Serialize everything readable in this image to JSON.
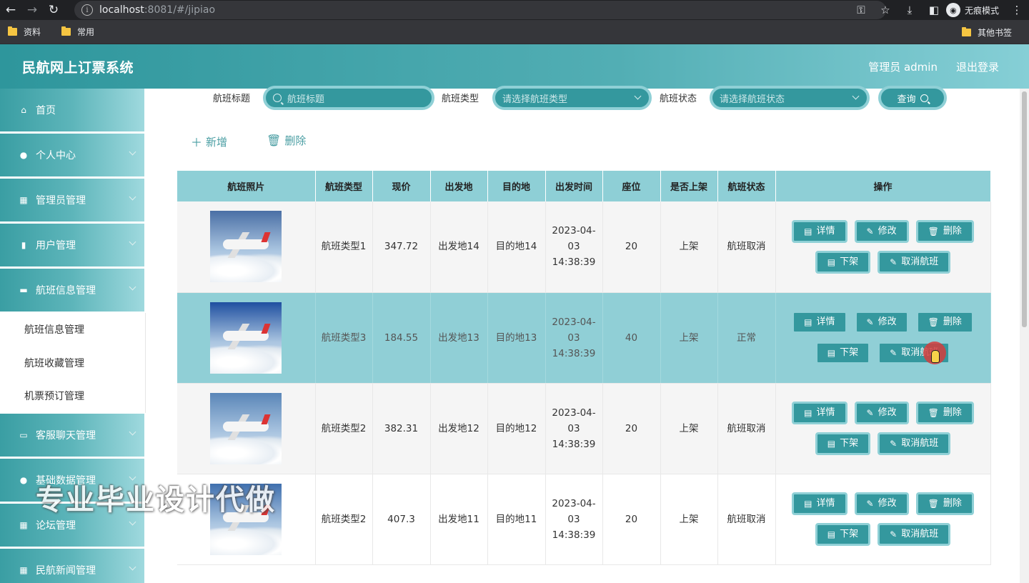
{
  "browser": {
    "url_host": "localhost",
    "url_rest": ":8081/#/jipiao",
    "incognito_label": "无痕模式",
    "bookmarks": [
      "资料",
      "常用"
    ],
    "other_bookmarks": "其他书签"
  },
  "header": {
    "title": "民航网上订票系统",
    "user": "管理员 admin",
    "logout": "退出登录"
  },
  "sidebar": {
    "items": [
      {
        "label": "首页",
        "icon": "home-icon",
        "glyph": "⌂"
      },
      {
        "label": "个人中心",
        "icon": "person-icon",
        "glyph": "●"
      },
      {
        "label": "管理员管理",
        "icon": "grid-icon",
        "glyph": "▦"
      },
      {
        "label": "用户管理",
        "icon": "chart-icon",
        "glyph": "▮"
      },
      {
        "label": "航班信息管理",
        "icon": "monitor-icon",
        "glyph": "▬"
      }
    ],
    "submenu": [
      "航班信息管理",
      "航班收藏管理",
      "机票预订管理"
    ],
    "items_after": [
      {
        "label": "客服聊天管理",
        "icon": "chat-icon",
        "glyph": "▭"
      },
      {
        "label": "基础数据管理",
        "icon": "person-icon",
        "glyph": "●"
      },
      {
        "label": "论坛管理",
        "icon": "grid-icon",
        "glyph": "▦"
      },
      {
        "label": "民航新闻管理",
        "icon": "grid-icon",
        "glyph": "▦"
      }
    ]
  },
  "watermark": "专业毕业设计代做",
  "search": {
    "title_label": "航班标题",
    "title_placeholder": "航班标题",
    "type_label": "航班类型",
    "type_placeholder": "请选择航班类型",
    "status_label": "航班状态",
    "status_placeholder": "请选择航班状态",
    "query_button": "查询"
  },
  "actions": {
    "add": "新增",
    "delete": "删除"
  },
  "table": {
    "headers": [
      "航班照片",
      "航班类型",
      "现价",
      "出发地",
      "目的地",
      "出发时间",
      "座位",
      "是否上架",
      "航班状态",
      "操作"
    ],
    "rows": [
      {
        "type": "航班类型1",
        "price": "347.72",
        "from": "出发地14",
        "to": "目的地14",
        "time": "2023-04-03 14:38:39",
        "seats": "20",
        "listed": "上架",
        "status": "航班取消"
      },
      {
        "type": "航班类型3",
        "price": "184.55",
        "from": "出发地13",
        "to": "目的地13",
        "time": "2023-04-03 14:38:39",
        "seats": "40",
        "listed": "上架",
        "status": "正常"
      },
      {
        "type": "航班类型2",
        "price": "382.31",
        "from": "出发地12",
        "to": "目的地12",
        "time": "2023-04-03 14:38:39",
        "seats": "20",
        "listed": "上架",
        "status": "航班取消"
      },
      {
        "type": "航班类型2",
        "price": "407.3",
        "from": "出发地11",
        "to": "目的地11",
        "time": "2023-04-03 14:38:39",
        "seats": "20",
        "listed": "上架",
        "status": "航班取消"
      }
    ],
    "op_labels": {
      "detail": "详情",
      "edit": "修改",
      "delete": "删除",
      "unlist": "下架",
      "cancel": "取消航班"
    }
  }
}
